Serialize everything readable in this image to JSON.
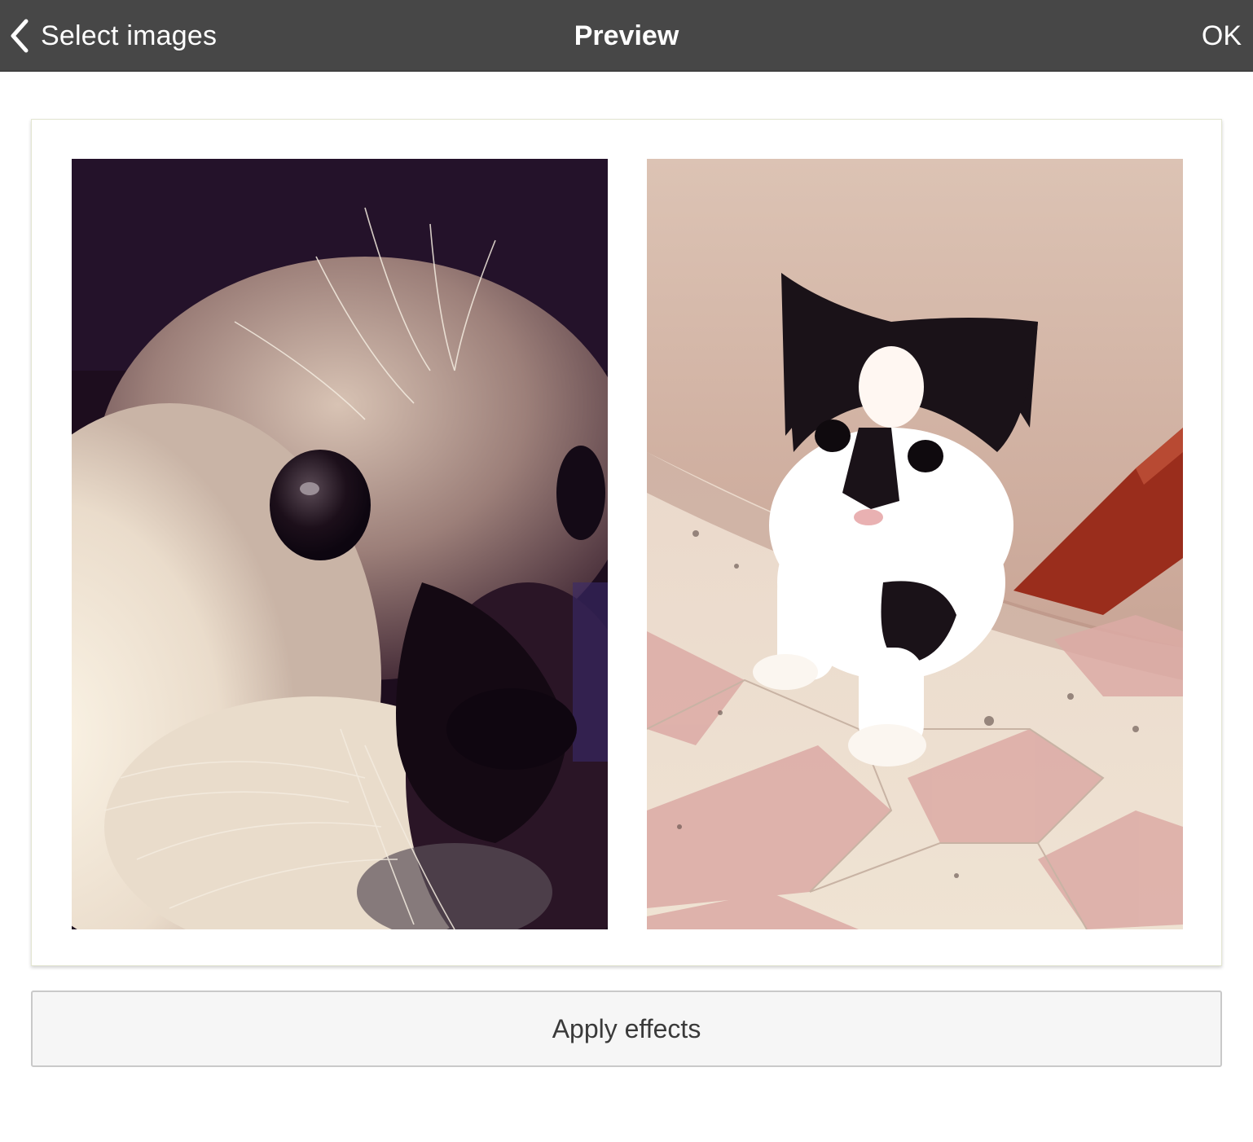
{
  "colors": {
    "topbar_bg": "#474747",
    "topbar_text": "#ffffff",
    "button_bg": "#f6f6f6",
    "button_border": "#c9c9c9"
  },
  "nav": {
    "back_icon": "chevron-left-icon",
    "back_label": "Select images",
    "title": "Preview",
    "ok_label": "OK"
  },
  "collage": {
    "photos": [
      {
        "subject": "close-up of a fluffy white and dark kitten face"
      },
      {
        "subject": "black and white kitten walking on a tiled floor"
      }
    ]
  },
  "actions": {
    "apply_label": "Apply effects"
  }
}
